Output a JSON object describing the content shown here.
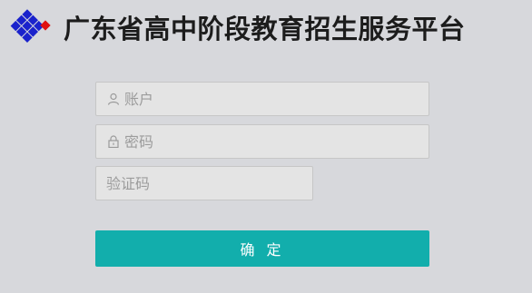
{
  "header": {
    "title": "广东省高中阶段教育招生服务平台",
    "logo_icon": "diamond-grid-logo",
    "logo_colors": [
      "#1a22cc",
      "#e01010"
    ]
  },
  "form": {
    "account": {
      "placeholder": "账户",
      "value": "",
      "icon": "user-icon"
    },
    "password": {
      "placeholder": "密码",
      "value": "",
      "icon": "lock-icon"
    },
    "captcha": {
      "placeholder": "验证码",
      "value": ""
    },
    "submit_label": "确 定"
  },
  "colors": {
    "background": "#d7d8dc",
    "submit": "#12aeac",
    "field_bg": "#e4e4e4"
  }
}
